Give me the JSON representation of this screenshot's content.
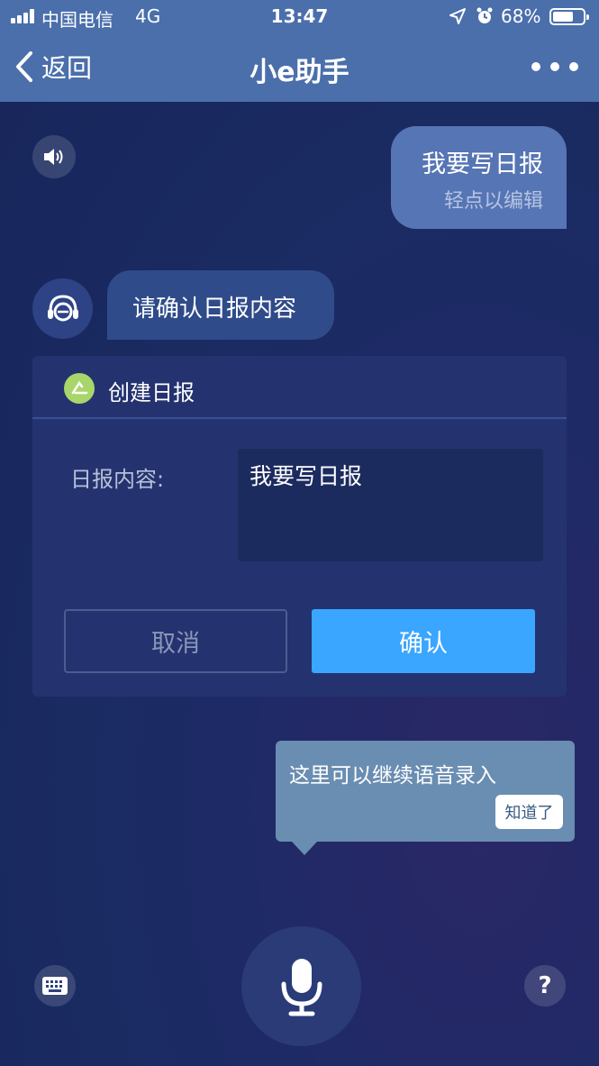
{
  "status_bar": {
    "carrier": "中国电信",
    "network": "4G",
    "time": "13:47",
    "battery": "68%",
    "battery_level": 0.68
  },
  "nav": {
    "back_label": "返回",
    "title": "小e助手",
    "more_icon": "more-dots-icon"
  },
  "messages": {
    "speaker_icon": "speaker-icon",
    "user_text": "我要写日报",
    "user_hint": "轻点以编辑",
    "bot_avatar_icon": "assistant-avatar-icon",
    "bot_text": "请确认日报内容"
  },
  "card": {
    "title": "创建日报",
    "field_label": "日报内容:",
    "field_value": "我要写日报",
    "cancel_label": "取消",
    "confirm_label": "确认"
  },
  "tooltip": {
    "text": "这里可以继续语音录入",
    "button": "知道了"
  },
  "bottom_bar": {
    "keyboard_icon": "keyboard-icon",
    "mic_icon": "microphone-icon",
    "help_label": "?"
  },
  "colors": {
    "header": "#4a6fab",
    "background": "#1a2b62",
    "confirm": "#3aa6ff",
    "user_bubble": "#5675b4",
    "bot_bubble": "#2f4b8a",
    "tooltip": "#6a8db2"
  }
}
